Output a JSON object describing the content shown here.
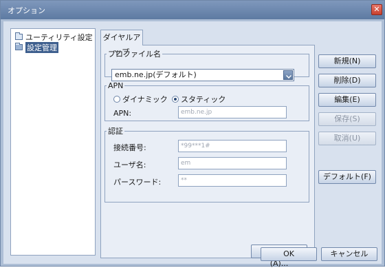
{
  "window": {
    "title": "オプション",
    "close_glyph": "✕"
  },
  "tree": {
    "items": [
      {
        "label": "ユーティリティ設定",
        "icon": "folder-closed-icon"
      },
      {
        "label": "設定管理",
        "icon": "folder-open-icon",
        "selected": true
      }
    ]
  },
  "tab": {
    "label": "ダイヤルアップ"
  },
  "profile": {
    "group_label": "プロファイル名",
    "selected": "emb.ne.jp(デフォルト)"
  },
  "apn": {
    "group_label": "APN",
    "radio_dynamic": "ダイナミック",
    "radio_static": "スタティック",
    "field_label": "APN:",
    "value": "emb.ne.jp"
  },
  "auth": {
    "group_label": "認証",
    "number_label": "接続番号:",
    "number_value": "*99***1#",
    "user_label": "ユーザ名:",
    "user_value": "em",
    "password_label": "パースワード:",
    "password_value": "**"
  },
  "buttons": {
    "advanced": "アドバンス(A)...",
    "new": "新規(N)",
    "delete": "削除(D)",
    "edit": "編集(E)",
    "save": "保存(S)",
    "cancel_edit": "取消(U)",
    "default": "デフォルト(F)",
    "ok": "OK",
    "cancel": "キャンセル"
  }
}
